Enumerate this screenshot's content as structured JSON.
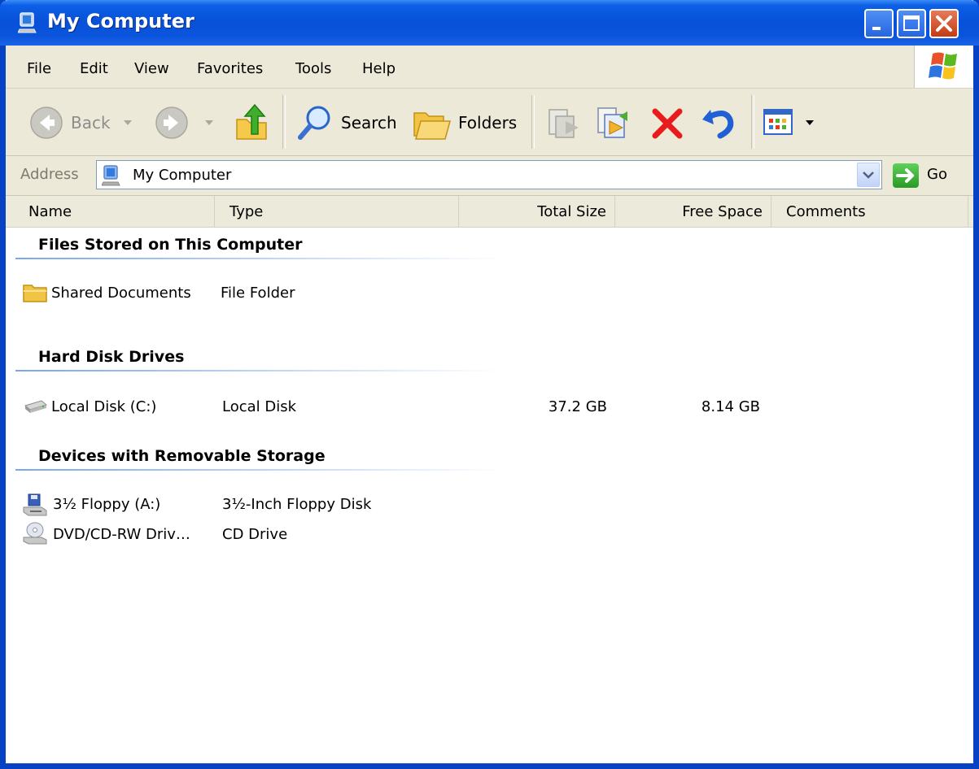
{
  "window": {
    "title": "My Computer",
    "controls": [
      "minimize",
      "maximize",
      "close"
    ]
  },
  "menu": [
    "File",
    "Edit",
    "View",
    "Favorites",
    "Tools",
    "Help"
  ],
  "toolbar": {
    "back_label": "Back",
    "search_label": "Search",
    "folders_label": "Folders"
  },
  "address": {
    "label": "Address",
    "value": "My Computer",
    "go_label": "Go"
  },
  "columns": [
    "Name",
    "Type",
    "Total Size",
    "Free Space",
    "Comments"
  ],
  "groups": [
    {
      "title": "Files Stored on This Computer",
      "items": [
        {
          "name": "Shared Documents",
          "type": "File Folder",
          "total": "",
          "free": "",
          "icon": "folder-icon"
        }
      ]
    },
    {
      "title": "Hard Disk Drives",
      "items": [
        {
          "name": "Local Disk (C:)",
          "type": "Local Disk",
          "total": "37.2 GB",
          "free": "8.14 GB",
          "icon": "hard-disk-icon"
        }
      ]
    },
    {
      "title": "Devices with Removable Storage",
      "items": [
        {
          "name": "3½ Floppy (A:)",
          "type": "3½-Inch Floppy Disk",
          "total": "",
          "free": "",
          "icon": "floppy-drive-icon"
        },
        {
          "name": "DVD/CD-RW Driv…",
          "type": "CD Drive",
          "total": "",
          "free": "",
          "icon": "cd-drive-icon"
        }
      ]
    }
  ],
  "colors": {
    "title_bar": "#0851d8",
    "chrome": "#ece9d8",
    "delete_red": "#e81c1c"
  }
}
